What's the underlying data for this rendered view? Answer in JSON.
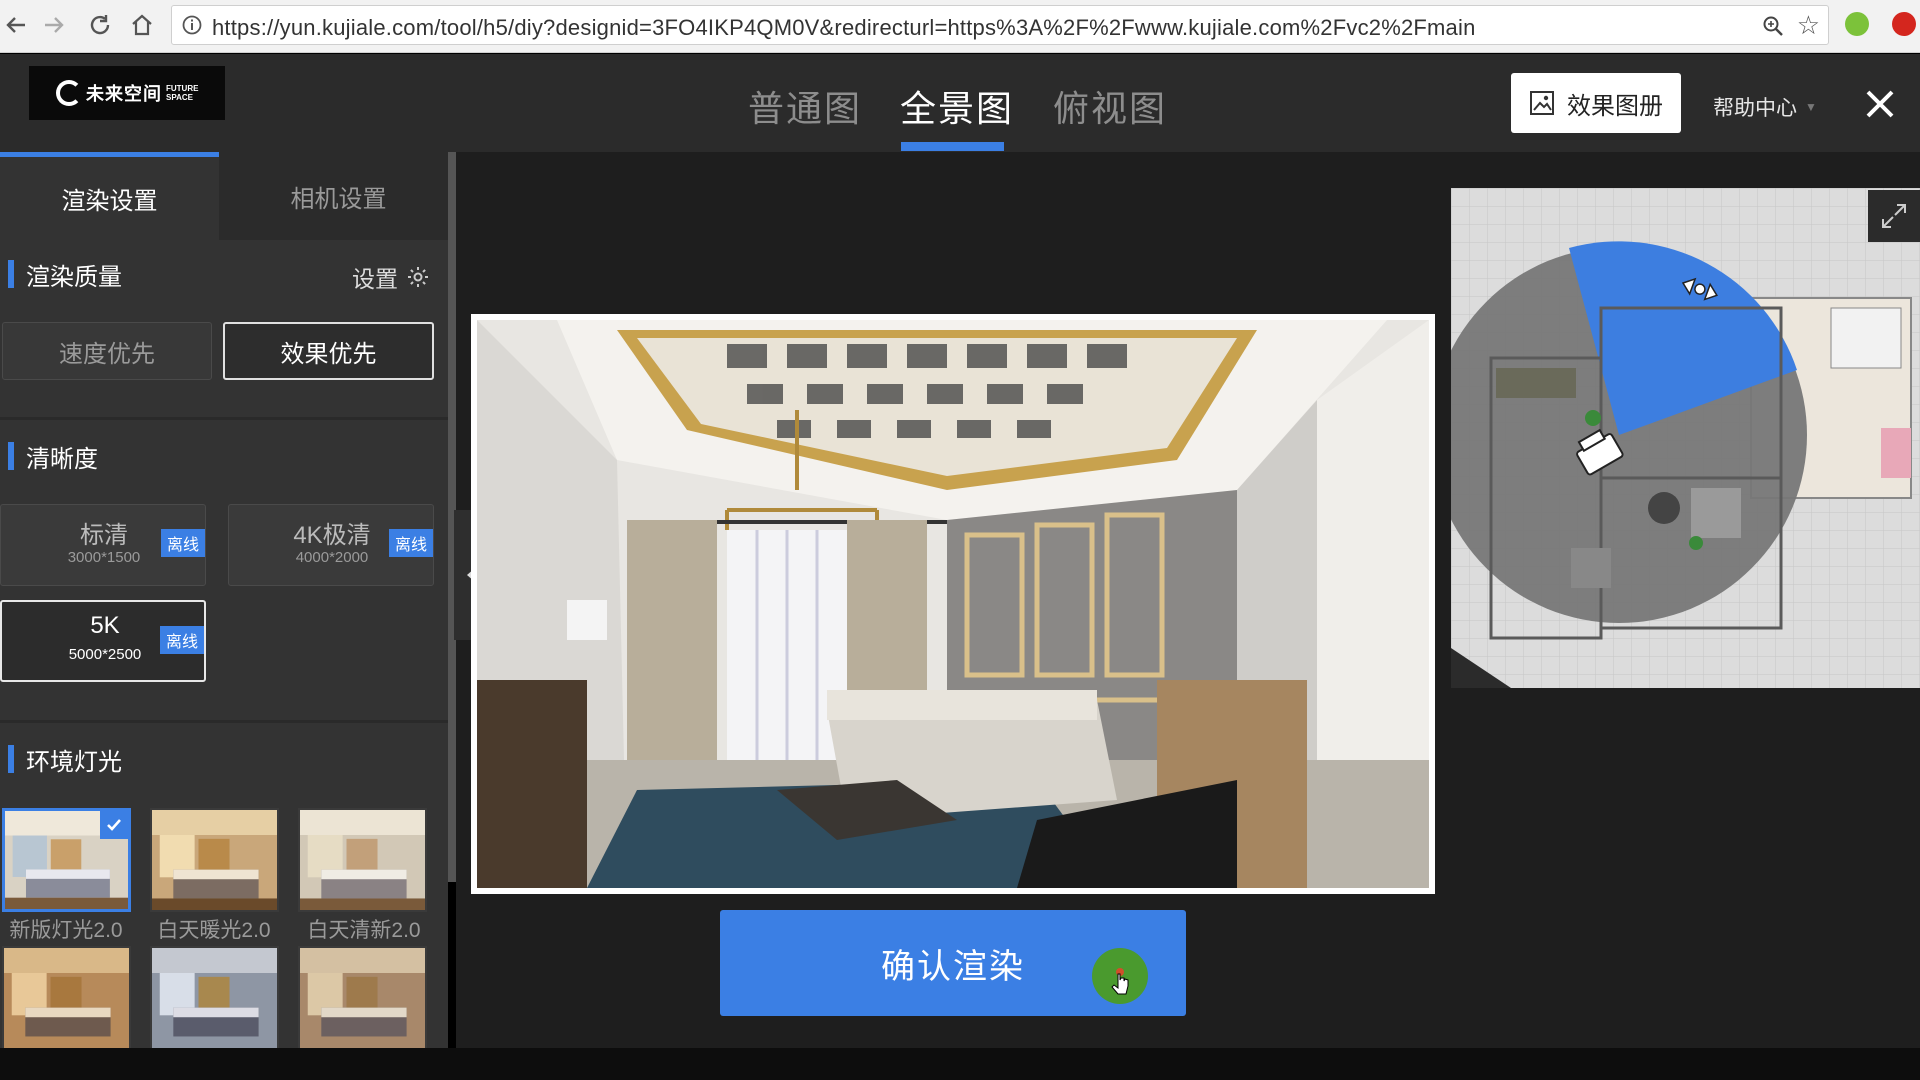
{
  "browser": {
    "url": "https://yun.kujiale.com/tool/h5/diy?designid=3FO4IKP4QM0V&redirecturl=https%3A%2F%2Fwww.kujiale.com%2Fvc2%2Fmain"
  },
  "header": {
    "logo_text": "未来空间",
    "logo_sub": "FUTURE SPACE",
    "tabs": [
      {
        "label": "普通图"
      },
      {
        "label": "全景图"
      },
      {
        "label": "俯视图"
      }
    ],
    "active_tab": "全景图",
    "album_label": "效果图册",
    "help_label": "帮助中心"
  },
  "panel": {
    "tabs": [
      {
        "label": "渲染设置"
      },
      {
        "label": "相机设置"
      }
    ],
    "quality": {
      "title": "渲染质量",
      "settings_label": "设置",
      "options": [
        {
          "label": "速度优先"
        },
        {
          "label": "效果优先"
        }
      ],
      "selected": "效果优先"
    },
    "resolution": {
      "title": "清晰度",
      "options": [
        {
          "name": "标清",
          "size": "3000*1500",
          "badge": "离线"
        },
        {
          "name": "4K极清",
          "size": "4000*2000",
          "badge": "离线"
        },
        {
          "name": "5K",
          "size": "5000*2500",
          "badge": "离线"
        }
      ],
      "selected": "5K"
    },
    "lighting": {
      "title": "环境灯光",
      "options": [
        {
          "label": "新版灯光2.0"
        },
        {
          "label": "白天暖光2.0"
        },
        {
          "label": "白天清新2.0"
        },
        {
          "label": ""
        },
        {
          "label": ""
        },
        {
          "label": ""
        }
      ],
      "selected": "新版灯光2.0"
    }
  },
  "viewport": {
    "confirm_label": "确认渲染"
  },
  "colors": {
    "accent": "#3b7fe4",
    "panel_bg": "#333333",
    "header_bg": "#2b2b2b",
    "viewport_bg": "#1e1e1e",
    "minimap_fov": "#3d7ee0"
  },
  "icons": {
    "back": "arrow-left-icon",
    "forward": "arrow-right-icon",
    "reload": "reload-icon",
    "home": "home-icon",
    "info": "info-icon",
    "zoom": "magnifier-icon",
    "bookmark": "star-icon",
    "album": "image-icon",
    "settings": "gear-icon",
    "close": "close-icon",
    "collapse": "caret-left-icon",
    "expand": "expand-icon",
    "check": "check-icon",
    "camera": "camera-icon"
  }
}
